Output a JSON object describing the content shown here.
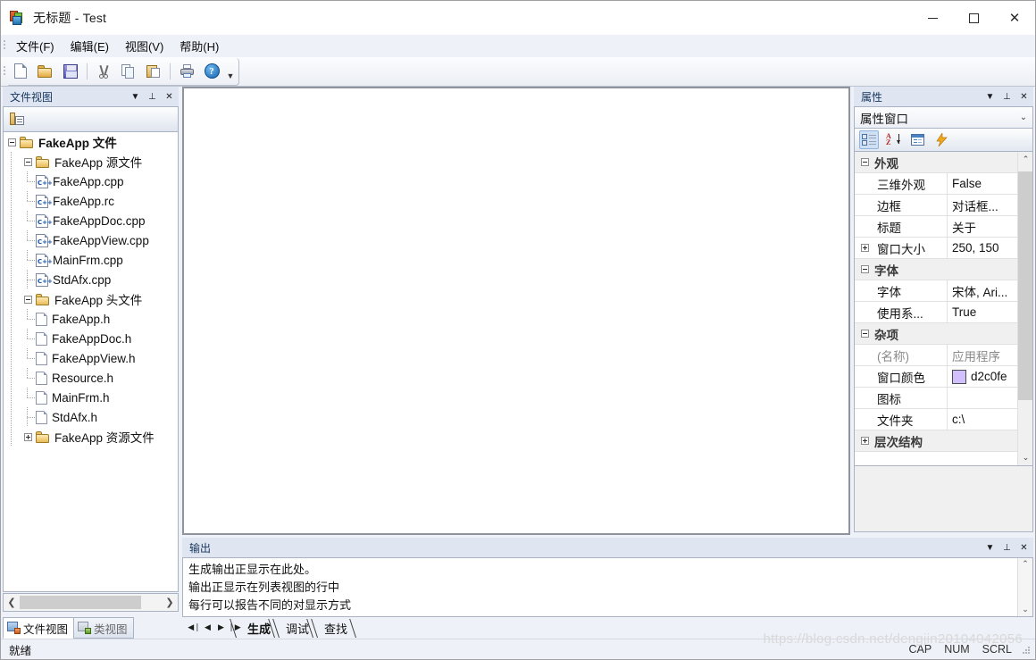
{
  "window": {
    "title": "无标题 - Test",
    "icon": "app-icon",
    "minimize": "—",
    "maximize": "□",
    "close": "✕"
  },
  "menubar": {
    "items": [
      {
        "label": "文件(F)",
        "name": "menu-file"
      },
      {
        "label": "编辑(E)",
        "name": "menu-edit"
      },
      {
        "label": "视图(V)",
        "name": "menu-view"
      },
      {
        "label": "帮助(H)",
        "name": "menu-help"
      }
    ]
  },
  "toolbar": {
    "buttons": [
      {
        "icon": "new-file-icon",
        "tip": "新建"
      },
      {
        "icon": "open-folder-icon",
        "tip": "打开"
      },
      {
        "icon": "save-icon",
        "tip": "保存"
      },
      {
        "icon": "cut-icon",
        "tip": "剪切"
      },
      {
        "icon": "copy-icon",
        "tip": "复制"
      },
      {
        "icon": "paste-icon",
        "tip": "粘贴"
      },
      {
        "icon": "print-icon",
        "tip": "打印"
      },
      {
        "icon": "help-icon",
        "tip": "帮助",
        "glyph": "?"
      }
    ],
    "overflow_glyph": "▼"
  },
  "fileview": {
    "title": "文件视图",
    "header_buttons": {
      "dropdown": "▼",
      "pin": "⊥",
      "close": "✕"
    },
    "toolbar_icon": "properties-window-icon",
    "tree": [
      {
        "label": "FakeApp 文件",
        "level": 0,
        "icon": "folder-icon",
        "expander": "minus",
        "bold": true
      },
      {
        "label": "FakeApp 源文件",
        "level": 1,
        "icon": "folder-icon",
        "expander": "minus",
        "bold": false
      },
      {
        "label": "FakeApp.cpp",
        "level": 2,
        "icon": "cpp-file-icon",
        "expander": "none",
        "bold": false
      },
      {
        "label": "FakeApp.rc",
        "level": 2,
        "icon": "cpp-file-icon",
        "expander": "none",
        "bold": false
      },
      {
        "label": "FakeAppDoc.cpp",
        "level": 2,
        "icon": "cpp-file-icon",
        "expander": "none",
        "bold": false
      },
      {
        "label": "FakeAppView.cpp",
        "level": 2,
        "icon": "cpp-file-icon",
        "expander": "none",
        "bold": false
      },
      {
        "label": "MainFrm.cpp",
        "level": 2,
        "icon": "cpp-file-icon",
        "expander": "none",
        "bold": false
      },
      {
        "label": "StdAfx.cpp",
        "level": 2,
        "icon": "cpp-file-icon",
        "expander": "none",
        "bold": false
      },
      {
        "label": "FakeApp 头文件",
        "level": 1,
        "icon": "folder-icon",
        "expander": "minus",
        "bold": false
      },
      {
        "label": "FakeApp.h",
        "level": 2,
        "icon": "header-file-icon",
        "expander": "none",
        "bold": false
      },
      {
        "label": "FakeAppDoc.h",
        "level": 2,
        "icon": "header-file-icon",
        "expander": "none",
        "bold": false
      },
      {
        "label": "FakeAppView.h",
        "level": 2,
        "icon": "header-file-icon",
        "expander": "none",
        "bold": false
      },
      {
        "label": "Resource.h",
        "level": 2,
        "icon": "header-file-icon",
        "expander": "none",
        "bold": false
      },
      {
        "label": "MainFrm.h",
        "level": 2,
        "icon": "header-file-icon",
        "expander": "none",
        "bold": false
      },
      {
        "label": "StdAfx.h",
        "level": 2,
        "icon": "header-file-icon",
        "expander": "none",
        "bold": false
      },
      {
        "label": "FakeApp 资源文件",
        "level": 1,
        "icon": "folder-icon",
        "expander": "plus",
        "bold": false
      }
    ],
    "hscroll": {
      "left_arrow": "❮",
      "right_arrow": "❯"
    },
    "tabs": [
      {
        "label": "文件视图",
        "name": "tab-file-view",
        "active": true,
        "icon": "file-view-icon"
      },
      {
        "label": "类视图",
        "name": "tab-class-view",
        "active": false,
        "icon": "class-view-icon"
      }
    ]
  },
  "properties": {
    "title": "属性",
    "header_buttons": {
      "dropdown": "▼",
      "pin": "⊥",
      "close": "✕"
    },
    "combo_value": "属性窗口",
    "combo_arrow": "⌄",
    "toolbar": [
      {
        "icon": "categorized-icon",
        "name": "props-categorized-button",
        "selected": true
      },
      {
        "icon": "alphabetical-icon",
        "name": "props-alphabetical-button",
        "selected": false
      },
      {
        "icon": "property-pages-icon",
        "name": "props-property-pages-button",
        "selected": false
      },
      {
        "icon": "events-icon",
        "name": "props-events-button",
        "selected": false
      }
    ],
    "rows": [
      {
        "kind": "category",
        "label": "外观",
        "toggle": "minus"
      },
      {
        "kind": "item",
        "name": "三维外观",
        "value": "False",
        "gutter": "",
        "dim": false
      },
      {
        "kind": "item",
        "name": "边框",
        "value": "对话框...",
        "gutter": "",
        "dim": false
      },
      {
        "kind": "item",
        "name": "标题",
        "value": "关于",
        "gutter": "",
        "dim": false
      },
      {
        "kind": "item",
        "name": "窗口大小",
        "value": "250, 150",
        "gutter": "plus",
        "dim": false
      },
      {
        "kind": "category",
        "label": "字体",
        "toggle": "minus"
      },
      {
        "kind": "item",
        "name": "字体",
        "value": "宋体, Ari...",
        "gutter": "",
        "dim": false
      },
      {
        "kind": "item",
        "name": "使用系...",
        "value": "True",
        "gutter": "",
        "dim": false
      },
      {
        "kind": "category",
        "label": "杂项",
        "toggle": "minus"
      },
      {
        "kind": "item",
        "name": "(名称)",
        "value": "应用程序",
        "gutter": "",
        "dim": true
      },
      {
        "kind": "item",
        "name": "窗口颜色",
        "value": "d2c0fe",
        "gutter": "",
        "dim": false,
        "swatch": "#d2c0fe"
      },
      {
        "kind": "item",
        "name": "图标",
        "value": "",
        "gutter": "",
        "dim": false
      },
      {
        "kind": "item",
        "name": "文件夹",
        "value": "c:\\",
        "gutter": "",
        "dim": false
      },
      {
        "kind": "category",
        "label": "层次结构",
        "toggle": "plus"
      }
    ],
    "scroll": {
      "up": "⌃",
      "down": "⌄"
    }
  },
  "output": {
    "title": "输出",
    "header_buttons": {
      "dropdown": "▼",
      "pin": "⊥",
      "close": "✕"
    },
    "lines": [
      "生成输出正显示在此处。",
      "输出正显示在列表视图的行中",
      "每行可以报告不同的对显示方式"
    ],
    "nav": {
      "first": "◀❘",
      "prev": "◀",
      "next": "▶",
      "last": "❘▶"
    },
    "tabs": [
      {
        "label": "生成",
        "name": "output-tab-build",
        "active": true
      },
      {
        "label": "调试",
        "name": "output-tab-debug",
        "active": false
      },
      {
        "label": "查找",
        "name": "output-tab-find",
        "active": false
      }
    ],
    "scroll": {
      "up": "⌃",
      "down": "⌄"
    }
  },
  "statusbar": {
    "message": "就绪",
    "indicators": [
      "CAP",
      "NUM",
      "SCRL"
    ]
  },
  "watermark": "https://blog.csdn.net/dengjin20104042056",
  "colors": {
    "panel_header": "#dfe6f2",
    "workspace": "#eef1f7",
    "accent": "#17365d",
    "window_color_swatch": "#d2c0fe"
  }
}
